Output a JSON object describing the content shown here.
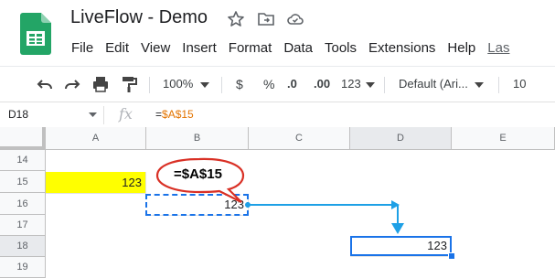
{
  "app": {
    "title": "LiveFlow - Demo",
    "menus": [
      "File",
      "Edit",
      "View",
      "Insert",
      "Format",
      "Data",
      "Tools",
      "Extensions",
      "Help",
      "Las"
    ]
  },
  "toolbar": {
    "zoom": "100%",
    "currency": "$",
    "percent": "%",
    "decrease_decimal": ".0",
    "increase_decimal": ".00",
    "number_format": "123",
    "font": "Default (Ari...",
    "font_size": "10"
  },
  "formula_bar": {
    "name_box": "D18",
    "fx_label": "fx",
    "formula_prefix": "=",
    "formula_ref": "$A$15"
  },
  "grid": {
    "columns": [
      "A",
      "B",
      "C",
      "D",
      "E"
    ],
    "rows": [
      "14",
      "15",
      "16",
      "17",
      "18",
      "19"
    ],
    "cells": {
      "A15": "123",
      "B16": "123",
      "D18": "123"
    },
    "selected_cell": "D18"
  },
  "annotation": {
    "callout_text": "=$A$15"
  },
  "colors": {
    "highlight_yellow": "#ffff00",
    "selection_blue": "#1a73e8",
    "arrow_blue": "#1ea0e6",
    "callout_red": "#d93025",
    "sheets_green": "#23a566"
  }
}
